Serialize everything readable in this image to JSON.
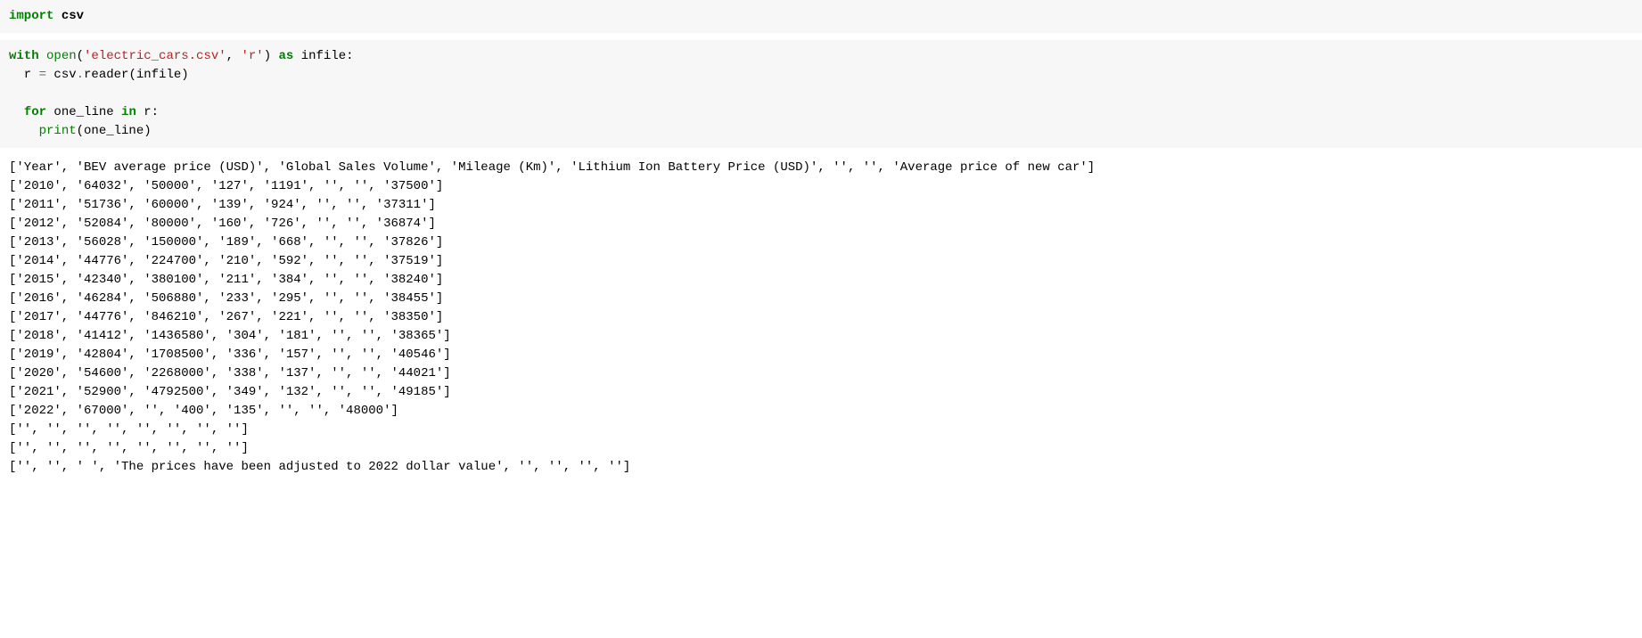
{
  "code_cell_1": {
    "tokens": [
      {
        "text": "import",
        "class": "kw-import"
      },
      {
        "text": " ",
        "class": ""
      },
      {
        "text": "csv",
        "class": "kw-module"
      }
    ]
  },
  "code_cell_2": {
    "lines": [
      [
        {
          "text": "with",
          "class": "kw-with"
        },
        {
          "text": " ",
          "class": ""
        },
        {
          "text": "open",
          "class": "fn-open"
        },
        {
          "text": "(",
          "class": ""
        },
        {
          "text": "'electric_cars.csv'",
          "class": "str"
        },
        {
          "text": ", ",
          "class": ""
        },
        {
          "text": "'r'",
          "class": "str"
        },
        {
          "text": ") ",
          "class": ""
        },
        {
          "text": "as",
          "class": "kw-as"
        },
        {
          "text": " infile:",
          "class": ""
        }
      ],
      [
        {
          "text": "  r ",
          "class": ""
        },
        {
          "text": "=",
          "class": "op"
        },
        {
          "text": " csv",
          "class": ""
        },
        {
          "text": ".",
          "class": "op"
        },
        {
          "text": "reader(infile)",
          "class": ""
        }
      ],
      [
        {
          "text": "",
          "class": ""
        }
      ],
      [
        {
          "text": "  ",
          "class": ""
        },
        {
          "text": "for",
          "class": "kw-for"
        },
        {
          "text": " one_line ",
          "class": ""
        },
        {
          "text": "in",
          "class": "kw-in"
        },
        {
          "text": " r:",
          "class": ""
        }
      ],
      [
        {
          "text": "    ",
          "class": ""
        },
        {
          "text": "print",
          "class": "fn-print"
        },
        {
          "text": "(one_line)",
          "class": ""
        }
      ]
    ]
  },
  "output_lines": [
    "['Year', 'BEV average price (USD)', 'Global Sales Volume', 'Mileage (Km)', 'Lithium Ion Battery Price (USD)', '', '', 'Average price of new car']",
    "['2010', '64032', '50000', '127', '1191', '', '', '37500']",
    "['2011', '51736', '60000', '139', '924', '', '', '37311']",
    "['2012', '52084', '80000', '160', '726', '', '', '36874']",
    "['2013', '56028', '150000', '189', '668', '', '', '37826']",
    "['2014', '44776', '224700', '210', '592', '', '', '37519']",
    "['2015', '42340', '380100', '211', '384', '', '', '38240']",
    "['2016', '46284', '506880', '233', '295', '', '', '38455']",
    "['2017', '44776', '846210', '267', '221', '', '', '38350']",
    "['2018', '41412', '1436580', '304', '181', '', '', '38365']",
    "['2019', '42804', '1708500', '336', '157', '', '', '40546']",
    "['2020', '54600', '2268000', '338', '137', '', '', '44021']",
    "['2021', '52900', '4792500', '349', '132', '', '', '49185']",
    "['2022', '67000', '', '400', '135', '', '', '48000']",
    "['', '', '', '', '', '', '', '']",
    "['', '', '', '', '', '', '', '']",
    "['', '', ' ', 'The prices have been adjusted to 2022 dollar value', '', '', '', '']"
  ]
}
